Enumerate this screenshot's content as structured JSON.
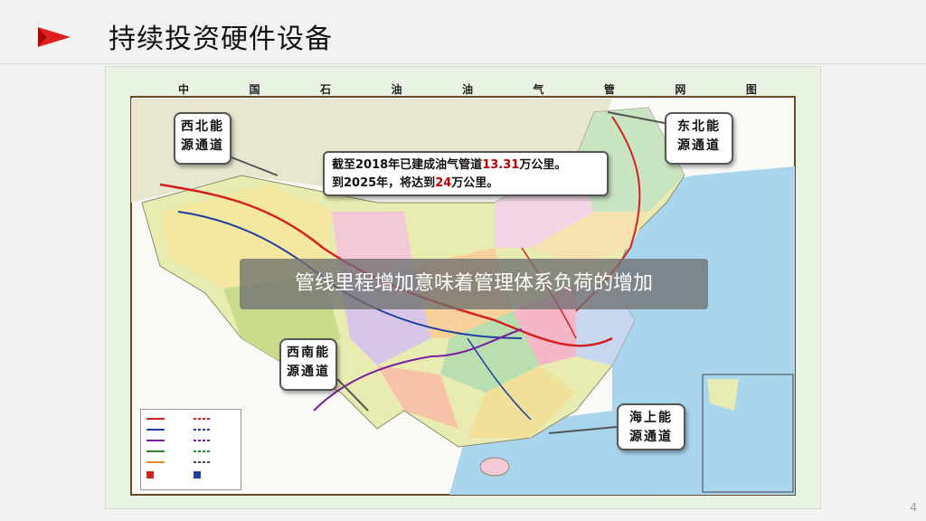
{
  "slide": {
    "title": "持续投资硬件设备",
    "page_number": "4"
  },
  "map": {
    "header_chars": [
      "中",
      "国",
      "石",
      "油",
      "油",
      "气",
      "管",
      "网",
      "图"
    ],
    "callouts": {
      "northwest": [
        "西北能",
        "源通道"
      ],
      "northeast": [
        "东北能",
        "源通道"
      ],
      "southwest": [
        "西南能",
        "源通道"
      ],
      "sea": [
        "海上能",
        "源通道"
      ]
    },
    "stat": {
      "line1_prefix": "截至2018年已建成油气管道",
      "line1_value": "13.31",
      "line1_suffix": "万公里。",
      "line2_prefix": "到2025年，将达到",
      "line2_value": "24",
      "line2_suffix": "万公里。"
    },
    "overlay_text": "管线里程增加意味着管理体系负荷的增加"
  },
  "colors": {
    "accent_red": "#c00000",
    "sea_blue": "#a9d5ee",
    "map_background": "#e9f3e3",
    "pipeline_red": "#d62020",
    "pipeline_blue": "#1f3fa0"
  },
  "icons": {
    "slide_icon": "red-arrowhead-icon"
  }
}
